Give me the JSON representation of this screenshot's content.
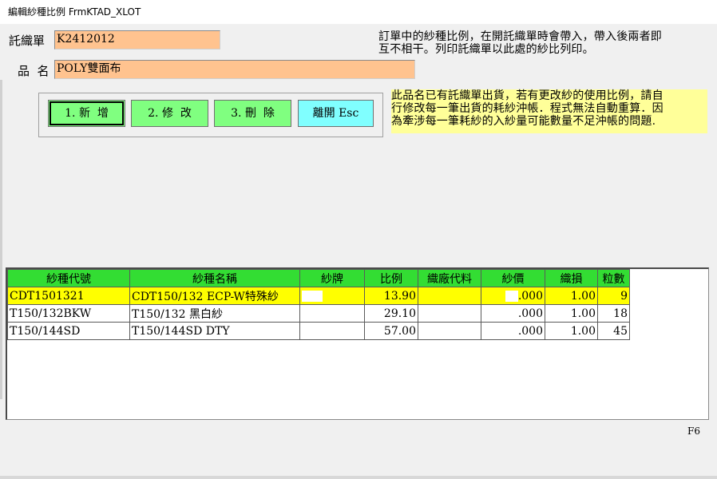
{
  "window": {
    "title": "編輯紗種比例  FrmKTAD_XLOT"
  },
  "form": {
    "order_label": "託織單",
    "order_value": "K2412012",
    "product_label": "品  名",
    "product_value": "POLY雙面布"
  },
  "notes": {
    "top": "訂單中的紗種比例，在開託織單時會帶入，帶入後兩者即\n互不相干。列印託織單以此處的紗比列印。",
    "warning": "此品名已有託織單出貨，若有更改紗的使用比例，請自\n行修改每一筆出貨的耗紗沖帳．程式無法自動重算．因\n為牽涉每一筆耗紗的入紗量可能數量不足沖帳的問題."
  },
  "buttons": {
    "add": "1. 新  增",
    "edit": "2. 修  改",
    "delete": "3. 刪  除",
    "exit": "離開 Esc"
  },
  "grid": {
    "headers": [
      "紗種代號",
      "紗種名稱",
      "紗牌",
      "比例",
      "織廠代料",
      "紗價",
      "織損",
      "粒數"
    ],
    "rows": [
      [
        "CDT1501321",
        "CDT150/132 ECP-W特殊紗",
        "",
        "13.90",
        "",
        ".000",
        "1.00",
        "9"
      ],
      [
        "T150/132BKW",
        "T150/132 黑白紗",
        "",
        "29.10",
        "",
        ".000",
        "1.00",
        "18"
      ],
      [
        "T150/144SD",
        "T150/144SD DTY",
        "",
        "57.00",
        "",
        ".000",
        "1.00",
        "45"
      ]
    ]
  },
  "status": {
    "hotkey": "F6"
  },
  "colors": {
    "field_bg": "#ffc38f",
    "header_bg": "#33dd33",
    "selected_row": "#ffff00",
    "button_green": "#80ff80",
    "button_cyan": "#80ffff",
    "note_bg": "#ffff99"
  }
}
